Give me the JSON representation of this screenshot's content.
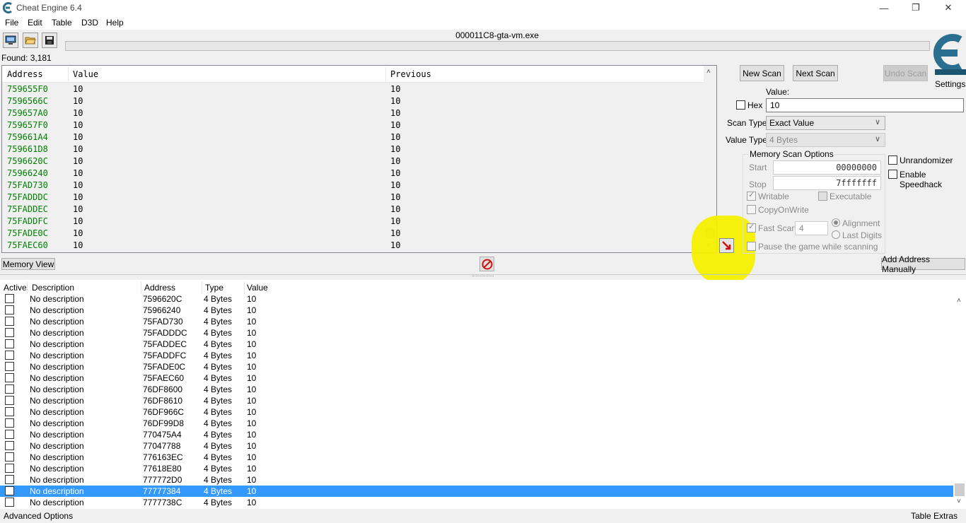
{
  "window": {
    "title": "Cheat Engine 6.4"
  },
  "menu": [
    "File",
    "Edit",
    "Table",
    "D3D",
    "Help"
  ],
  "process_name": "000011C8-gta-vm.exe",
  "found_label": "Found: 3,181",
  "results": {
    "headers": {
      "address": "Address",
      "value": "Value",
      "previous": "Previous"
    },
    "rows": [
      {
        "address": "759655F0",
        "value": "10",
        "previous": "10"
      },
      {
        "address": "7596566C",
        "value": "10",
        "previous": "10"
      },
      {
        "address": "759657A0",
        "value": "10",
        "previous": "10"
      },
      {
        "address": "759657F0",
        "value": "10",
        "previous": "10"
      },
      {
        "address": "759661A4",
        "value": "10",
        "previous": "10"
      },
      {
        "address": "759661D8",
        "value": "10",
        "previous": "10"
      },
      {
        "address": "7596620C",
        "value": "10",
        "previous": "10"
      },
      {
        "address": "75966240",
        "value": "10",
        "previous": "10"
      },
      {
        "address": "75FAD730",
        "value": "10",
        "previous": "10"
      },
      {
        "address": "75FADDDC",
        "value": "10",
        "previous": "10"
      },
      {
        "address": "75FADDEC",
        "value": "10",
        "previous": "10"
      },
      {
        "address": "75FADDFC",
        "value": "10",
        "previous": "10"
      },
      {
        "address": "75FADE0C",
        "value": "10",
        "previous": "10"
      },
      {
        "address": "75FAEC60",
        "value": "10",
        "previous": "10"
      }
    ]
  },
  "scan": {
    "new_scan": "New Scan",
    "next_scan": "Next Scan",
    "undo_scan": "Undo Scan",
    "settings": "Settings",
    "value_label": "Value:",
    "hex_label": "Hex",
    "value": "10",
    "scan_type_label": "Scan Type",
    "scan_type": "Exact Value",
    "value_type_label": "Value Type",
    "value_type": "4 Bytes"
  },
  "memory_options": {
    "title": "Memory Scan Options",
    "start_label": "Start",
    "start": "00000000",
    "stop_label": "Stop",
    "stop": "7fffffff",
    "writable": "Writable",
    "executable": "Executable",
    "copy_on_write": "CopyOnWrite",
    "fast_scan": "Fast Scan",
    "fast_scan_value": "4",
    "alignment": "Alignment",
    "last_digits": "Last Digits",
    "pause_game": "Pause the game while scanning"
  },
  "extra_options": {
    "unrandomizer": "Unrandomizer",
    "speedhack": "Enable Speedhack"
  },
  "memory_view_label": "Memory View",
  "add_address_label": "Add Address Manually",
  "table": {
    "headers": {
      "active": "Active",
      "description": "Description",
      "address": "Address",
      "type": "Type",
      "value": "Value"
    },
    "rows": [
      {
        "description": "No description",
        "address": "7596620C",
        "type": "4 Bytes",
        "value": "10"
      },
      {
        "description": "No description",
        "address": "75966240",
        "type": "4 Bytes",
        "value": "10"
      },
      {
        "description": "No description",
        "address": "75FAD730",
        "type": "4 Bytes",
        "value": "10"
      },
      {
        "description": "No description",
        "address": "75FADDDC",
        "type": "4 Bytes",
        "value": "10"
      },
      {
        "description": "No description",
        "address": "75FADDEC",
        "type": "4 Bytes",
        "value": "10"
      },
      {
        "description": "No description",
        "address": "75FADDFC",
        "type": "4 Bytes",
        "value": "10"
      },
      {
        "description": "No description",
        "address": "75FADE0C",
        "type": "4 Bytes",
        "value": "10"
      },
      {
        "description": "No description",
        "address": "75FAEC60",
        "type": "4 Bytes",
        "value": "10"
      },
      {
        "description": "No description",
        "address": "76DF8600",
        "type": "4 Bytes",
        "value": "10"
      },
      {
        "description": "No description",
        "address": "76DF8610",
        "type": "4 Bytes",
        "value": "10"
      },
      {
        "description": "No description",
        "address": "76DF966C",
        "type": "4 Bytes",
        "value": "10"
      },
      {
        "description": "No description",
        "address": "76DF99D8",
        "type": "4 Bytes",
        "value": "10"
      },
      {
        "description": "No description",
        "address": "770475A4",
        "type": "4 Bytes",
        "value": "10"
      },
      {
        "description": "No description",
        "address": "77047788",
        "type": "4 Bytes",
        "value": "10"
      },
      {
        "description": "No description",
        "address": "776163EC",
        "type": "4 Bytes",
        "value": "10"
      },
      {
        "description": "No description",
        "address": "77618E80",
        "type": "4 Bytes",
        "value": "10"
      },
      {
        "description": "No description",
        "address": "777772D0",
        "type": "4 Bytes",
        "value": "10"
      },
      {
        "description": "No description",
        "address": "77777384",
        "type": "4 Bytes",
        "value": "10",
        "selected": true
      },
      {
        "description": "No description",
        "address": "7777738C",
        "type": "4 Bytes",
        "value": "10"
      }
    ]
  },
  "status": {
    "advanced_options": "Advanced Options",
    "table_extras": "Table Extras"
  },
  "colors": {
    "address_green": "#008000",
    "selection_blue": "#3399ff",
    "highlight_yellow": "#f4f000"
  }
}
